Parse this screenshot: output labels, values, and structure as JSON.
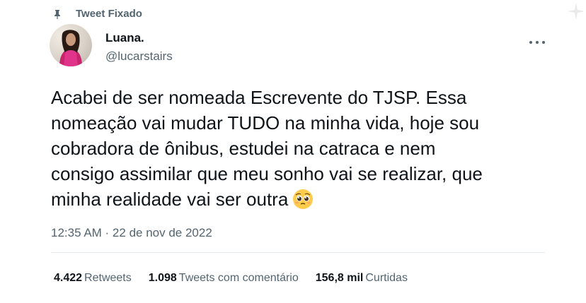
{
  "pinned": {
    "label": "Tweet Fixado",
    "icon": "pin-icon"
  },
  "user": {
    "name": "Luana.",
    "handle": "@lucarstairs"
  },
  "tweet": {
    "lines": [
      "Acabei de ser nomeada Escrevente do TJSP. Essa",
      "nomeação vai mudar TUDO na minha vida, hoje sou",
      "cobradora de ônibus, estudei na catraca e nem",
      "consigo assimilar que meu sonho vai se realizar, que",
      "minha realidade vai ser outra"
    ],
    "emoji": "pleading-face-emoji",
    "timestamp": "12:35 AM · 22 de nov de 2022"
  },
  "stats": {
    "retweets_count": "4.422",
    "retweets_label": "Retweets",
    "quotes_count": "1.098",
    "quotes_label": "Tweets com comentário",
    "likes_count": "156,8 mil",
    "likes_label": "Curtidas"
  },
  "colors": {
    "text": "#0f1419",
    "secondary": "#536471",
    "divider": "#e6ecf0"
  }
}
